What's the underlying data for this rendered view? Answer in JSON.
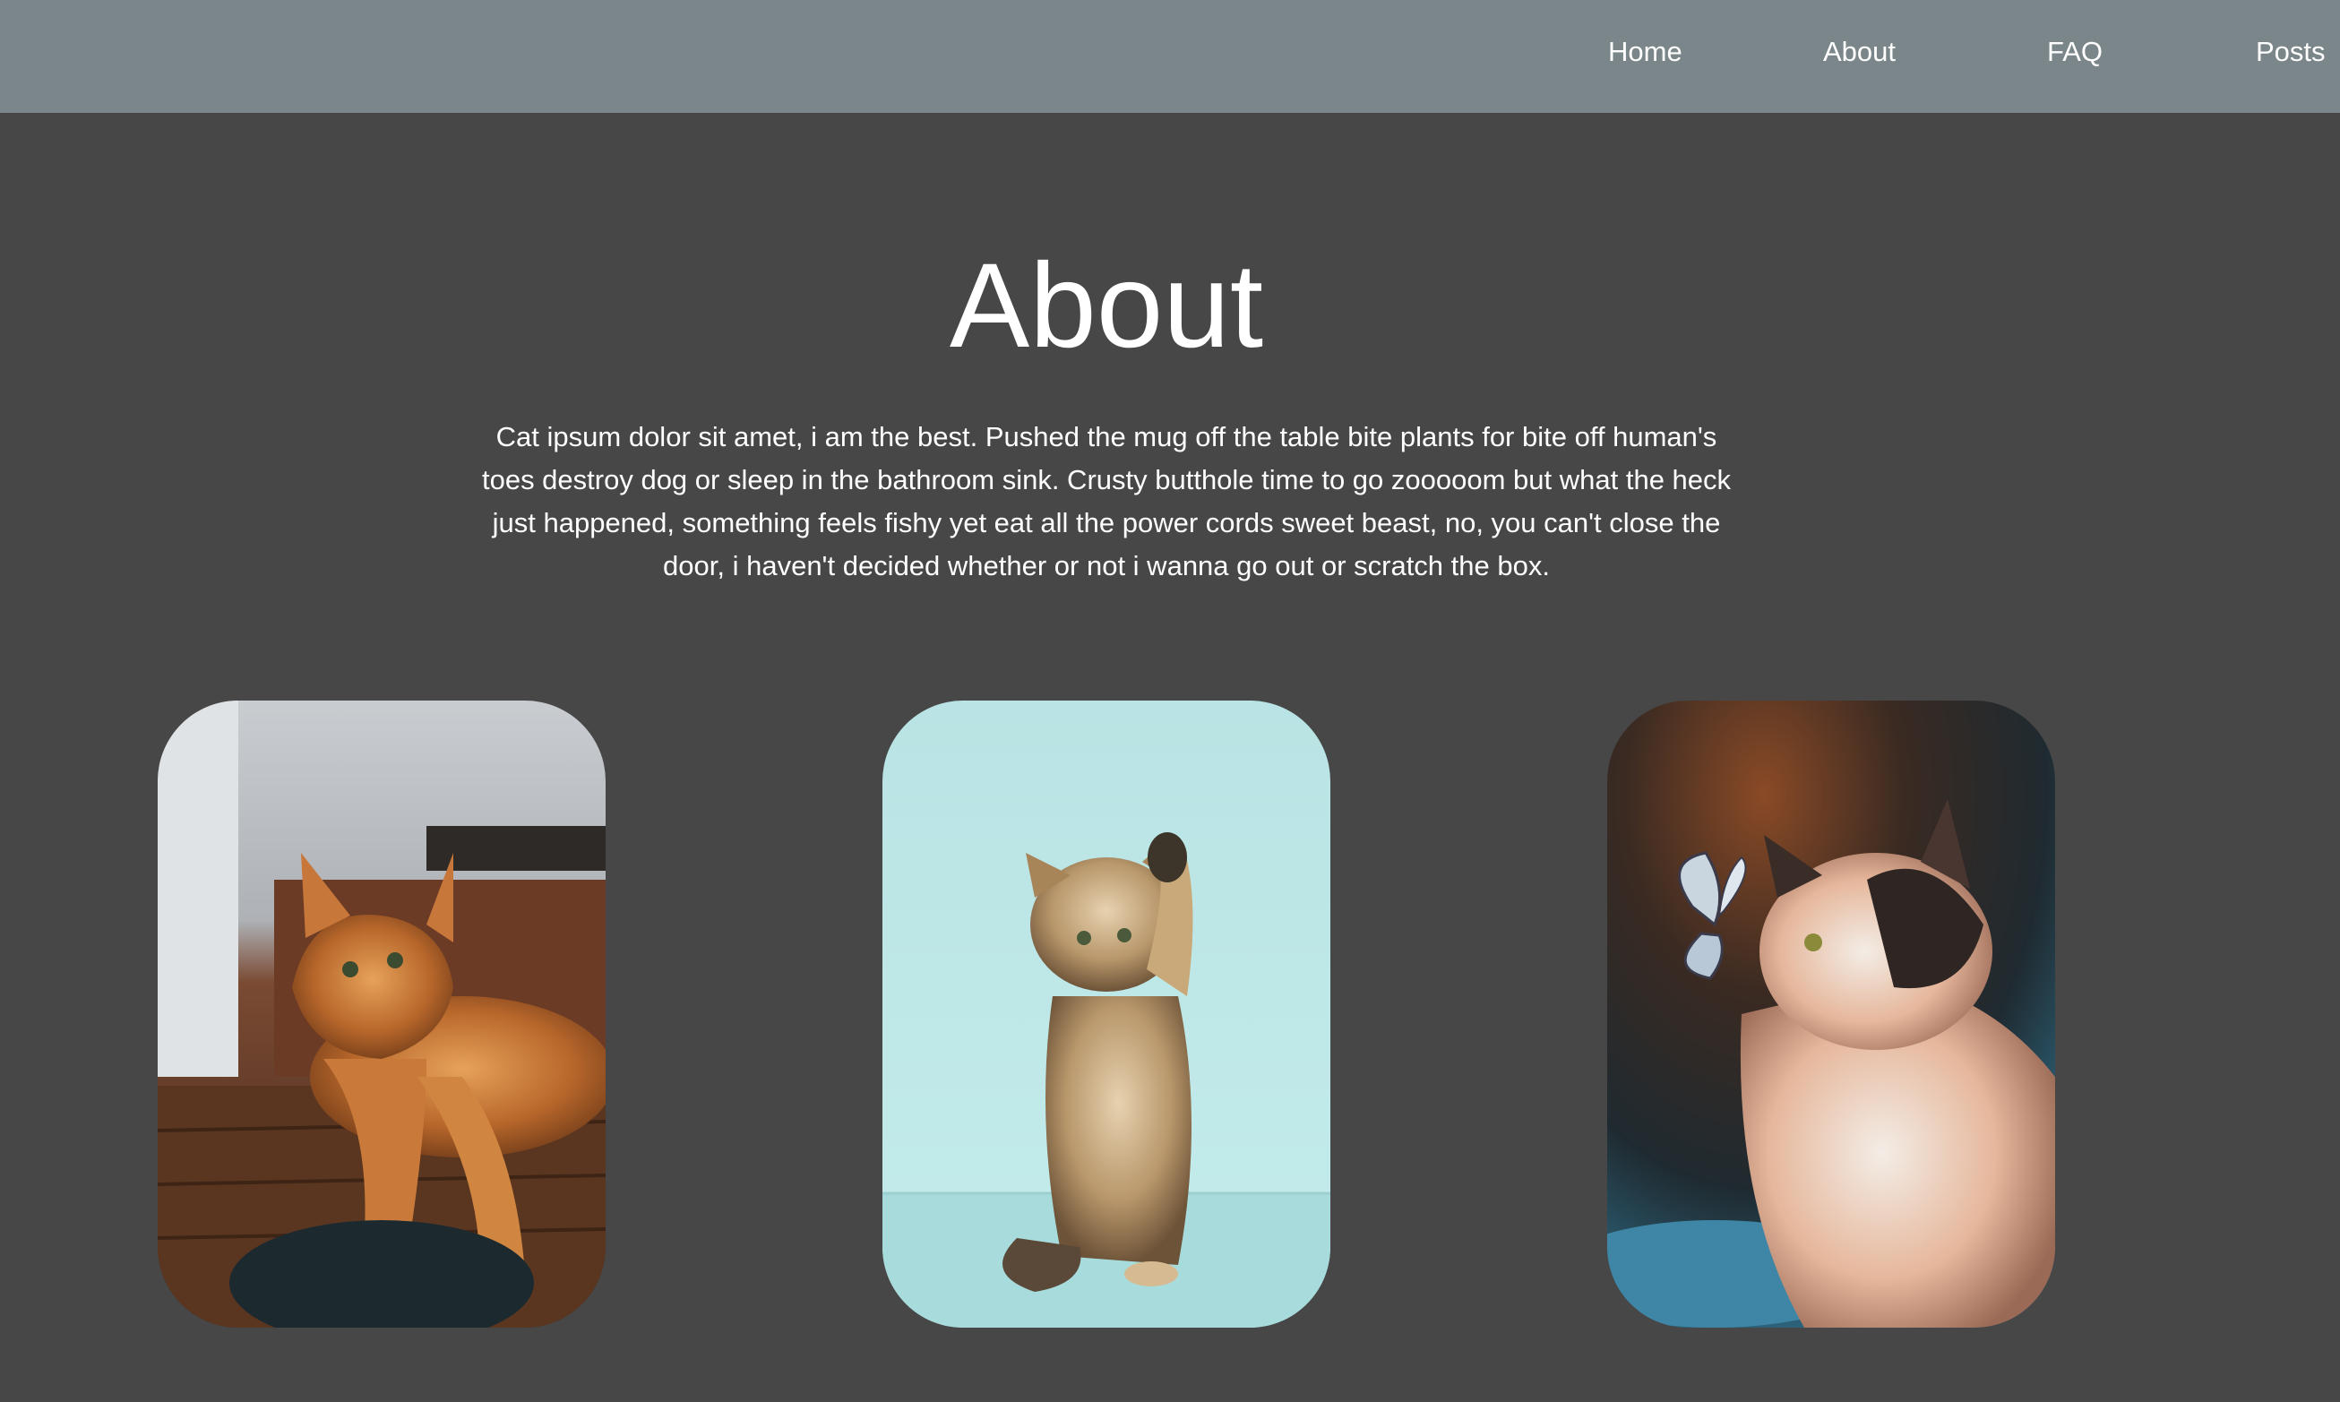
{
  "nav": {
    "items": [
      {
        "label": "Home"
      },
      {
        "label": "About"
      },
      {
        "label": "FAQ"
      },
      {
        "label": "Posts"
      }
    ]
  },
  "main": {
    "title": "About",
    "paragraph": "Cat ipsum dolor sit amet, i am the best. Pushed the mug off the table bite plants for bite off human's toes destroy dog or sleep in the bathroom sink. Crusty butthole time to go zooooom but what the heck just happened, something feels fishy yet eat all the power cords sweet beast, no, you can't close the door, i haven't decided whether or not i wanna go out or scratch the box."
  },
  "gallery": {
    "images": [
      {
        "subject": "orange long-haired cat lying on wooden table"
      },
      {
        "subject": "fluffy kitten reaching paw up on teal background"
      },
      {
        "subject": "calico cat with butterfly on nose"
      }
    ]
  },
  "colors": {
    "navbar_bg": "#7a8689",
    "page_bg": "#474747",
    "text": "#ffffff"
  }
}
